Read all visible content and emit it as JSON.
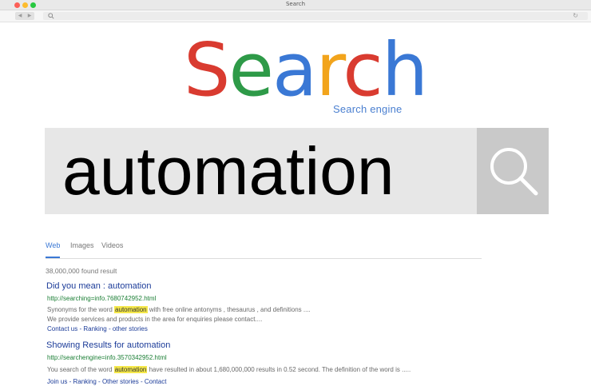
{
  "window": {
    "title": "Search"
  },
  "toolbar": {
    "back_icon": "chevron-left-icon",
    "forward_icon": "chevron-right-icon",
    "address_value": ""
  },
  "logo": {
    "letters": [
      {
        "char": "S",
        "color": "#d93b30"
      },
      {
        "char": "e",
        "color": "#2e9a48"
      },
      {
        "char": "a",
        "color": "#3a78d5"
      },
      {
        "char": "r",
        "color": "#f2a41c"
      },
      {
        "char": "c",
        "color": "#d93b30"
      },
      {
        "char": "h",
        "color": "#3a78d5"
      }
    ],
    "subtitle": "Search engine"
  },
  "search": {
    "query": "automation",
    "button_icon": "search-icon"
  },
  "tabs": [
    {
      "label": "Web",
      "active": true
    },
    {
      "label": "Images",
      "active": false
    },
    {
      "label": "Videos",
      "active": false
    }
  ],
  "results_count": "38,000,000 found result",
  "results": [
    {
      "title": "Did you mean : automation",
      "url": "http://searching=info.7680742952.html",
      "desc1_pre": "Synonyms for the word ",
      "desc1_hl": "automation",
      "desc1_post": " with free online antonyms , thesaurus , and definitions ....",
      "desc2": "We provide services and products in the area for enquiries please contact....",
      "links": [
        "Contact us",
        "Ranking",
        "other stories"
      ]
    },
    {
      "title": "Showing Results for automation",
      "url": "http://searchengine=info.3570342952.html",
      "desc1_pre": "You search of the word ",
      "desc1_hl": "automation",
      "desc1_post": " have resulted in about 1,680,000,000 results in 0.52 second. The definition of the word is .....",
      "links": [
        "Join us",
        "Ranking",
        "Other stories",
        "Contact"
      ]
    }
  ],
  "colors": {
    "accent": "#3a78d5",
    "title_link": "#1c3c99",
    "url_green": "#1a7e34",
    "highlight": "#f5e84a"
  }
}
